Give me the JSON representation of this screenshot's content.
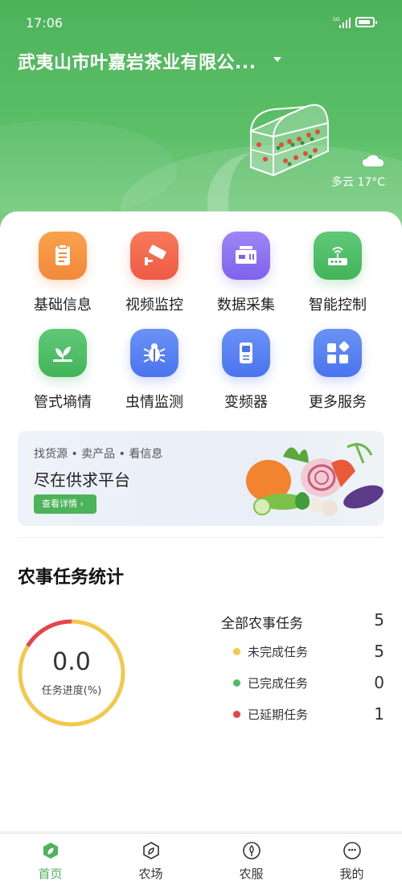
{
  "status_bar": {
    "time": "17:06",
    "network": "5G"
  },
  "header": {
    "company": "武夷山市叶嘉岩茶业有限公...",
    "weather": "多云 17°C"
  },
  "grid": [
    {
      "label": "基础信息",
      "icon": "clipboard-icon",
      "color": "#f5953c"
    },
    {
      "label": "视频监控",
      "icon": "camera-icon",
      "color": "#f2644a"
    },
    {
      "label": "数据采集",
      "icon": "data-box-icon",
      "color": "#8f73f0"
    },
    {
      "label": "智能控制",
      "icon": "router-icon",
      "color": "#4cbc64"
    },
    {
      "label": "管式墒情",
      "icon": "sprout-icon",
      "color": "#4cbc64"
    },
    {
      "label": "虫情监测",
      "icon": "bug-icon",
      "color": "#4f7df0"
    },
    {
      "label": "变频器",
      "icon": "inverter-icon",
      "color": "#4f7df0"
    },
    {
      "label": "更多服务",
      "icon": "apps-icon",
      "color": "#4f7df0"
    }
  ],
  "banner": {
    "tags": "找货源 • 卖产品 • 看信息",
    "title": "尽在供求平台",
    "button": "查看详情 ›"
  },
  "tasks": {
    "title": "农事任务统计",
    "progress_value": "0.0",
    "progress_label": "任务进度(%)",
    "total_label": "全部农事任务",
    "total": "5",
    "items": [
      {
        "label": "未完成任务",
        "value": "5",
        "color": "#f2c94c"
      },
      {
        "label": "已完成任务",
        "value": "0",
        "color": "#4cbc64"
      },
      {
        "label": "已延期任务",
        "value": "1",
        "color": "#e8434a"
      }
    ]
  },
  "tabbar": [
    {
      "label": "首页",
      "icon": "home-leaf-icon",
      "active": true
    },
    {
      "label": "农场",
      "icon": "farm-leaf-icon",
      "active": false
    },
    {
      "label": "农服",
      "icon": "service-icon",
      "active": false
    },
    {
      "label": "我的",
      "icon": "profile-icon",
      "active": false
    }
  ],
  "colors": {
    "primary": "#4db35a",
    "ring_main": "#f2c94c",
    "ring_delay": "#e8434a"
  }
}
